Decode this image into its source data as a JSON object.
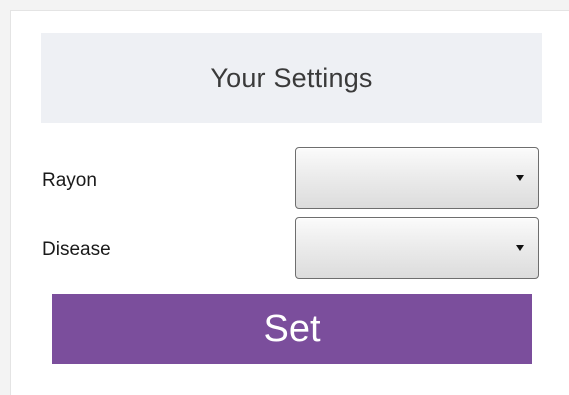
{
  "header": {
    "title": "Your Settings"
  },
  "fields": {
    "rayon": {
      "label": "Rayon",
      "value": ""
    },
    "disease": {
      "label": "Disease",
      "value": ""
    }
  },
  "actions": {
    "set_label": "Set"
  },
  "colors": {
    "accent": "#7b4e9c",
    "header_bg": "#eef0f4"
  },
  "icons": {
    "dropdown": "caret-down-icon"
  }
}
